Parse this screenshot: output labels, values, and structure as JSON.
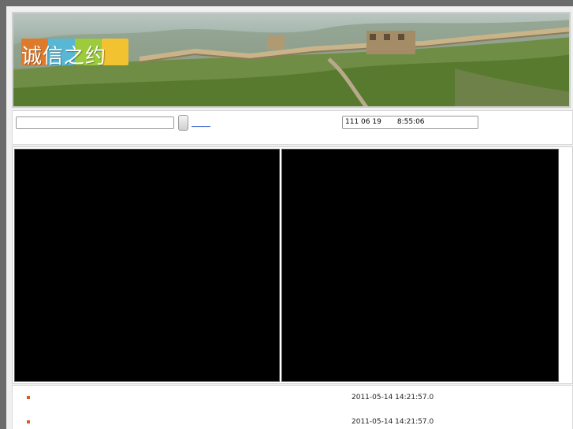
{
  "banner": {
    "logo_text": "诚信之约",
    "logo_colors": [
      "#e07a2b",
      "#58b7d4",
      "#9ccb3c",
      "#f2c230"
    ]
  },
  "toolbar": {
    "search_value": "",
    "link_text": "____",
    "clock_text": "111 06 19       8:55:06"
  },
  "log": {
    "entries": [
      {
        "time": "2011-05-14 14:21:57.0"
      },
      {
        "time": "2011-05-14 14:21:57.0"
      }
    ]
  },
  "colors": {
    "bullet": "#e0581a",
    "link": "#3a5fcd"
  }
}
